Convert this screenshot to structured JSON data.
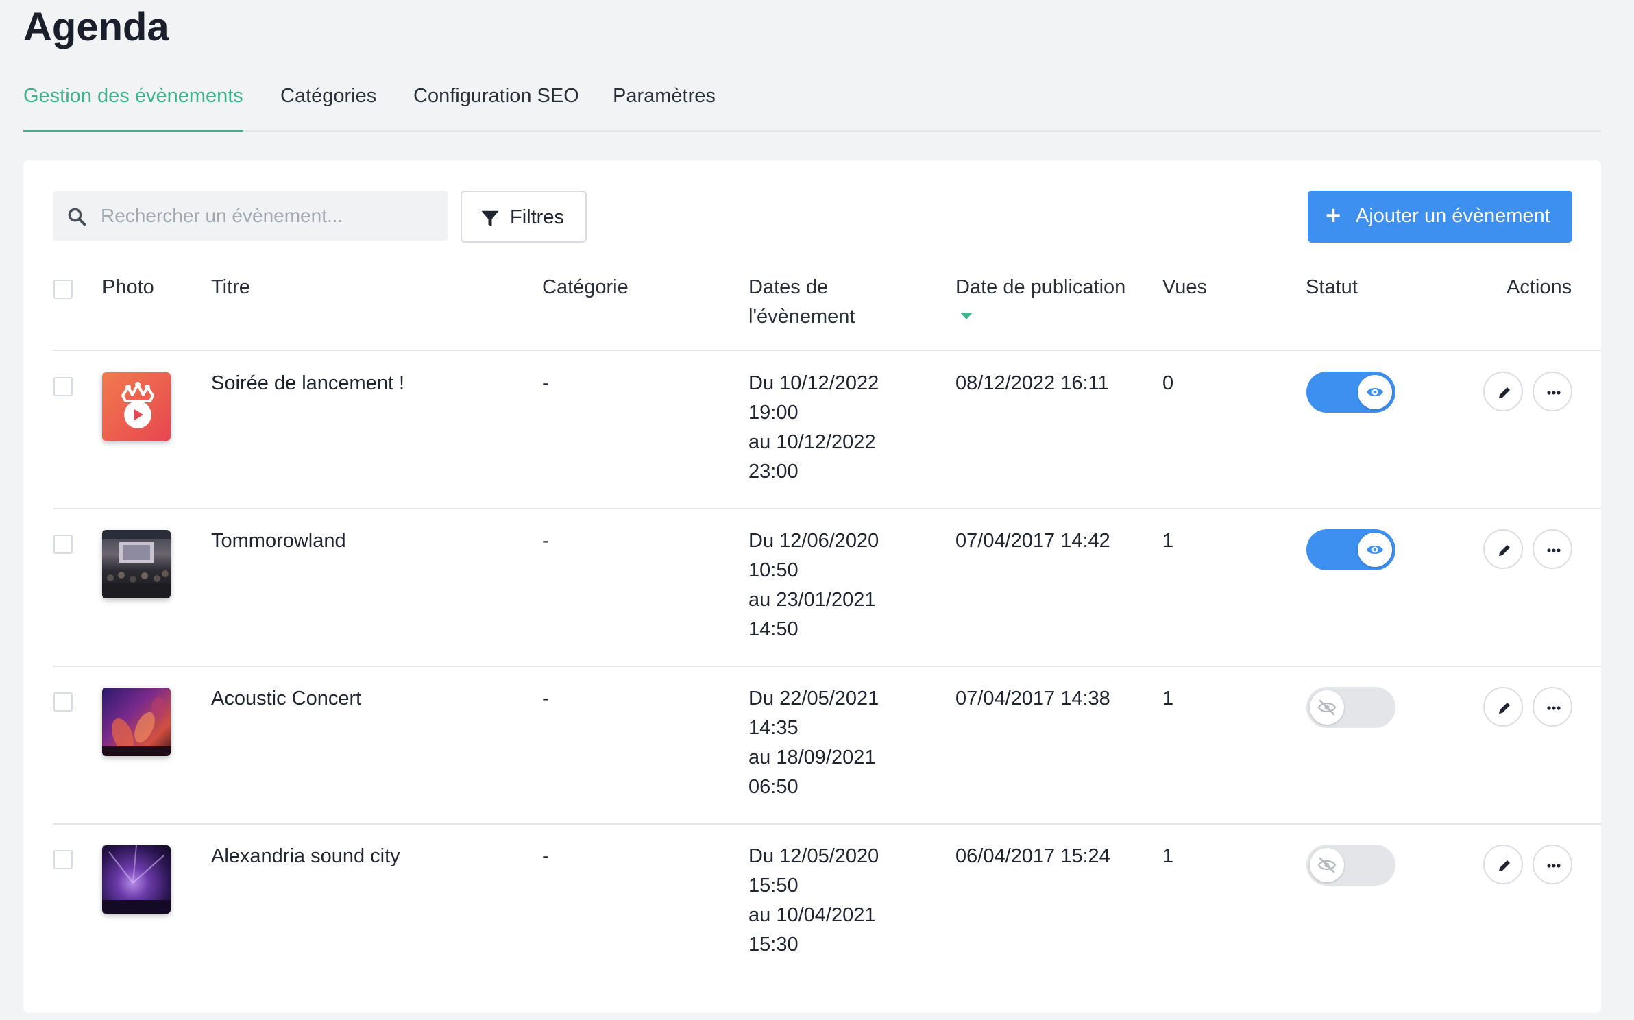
{
  "page": {
    "title": "Agenda"
  },
  "tabs": [
    {
      "label": "Gestion des évènements",
      "active": true
    },
    {
      "label": "Catégories",
      "active": false
    },
    {
      "label": "Configuration SEO",
      "active": false
    },
    {
      "label": "Paramètres",
      "active": false
    }
  ],
  "toolbar": {
    "search_placeholder": "Rechercher un évènement...",
    "filters_label": "Filtres",
    "add_label": "Ajouter un évènement"
  },
  "table": {
    "headers": {
      "photo": "Photo",
      "title": "Titre",
      "category": "Catégorie",
      "dates_line1": "Dates de",
      "dates_line2": "l'évènement",
      "publication": "Date de publication",
      "views": "Vues",
      "status": "Statut",
      "actions": "Actions"
    },
    "sort": {
      "column": "Date de publication",
      "direction": "desc"
    },
    "rows": [
      {
        "title": "Soirée de lancement !",
        "category": "-",
        "date_line1": "Du 10/12/2022",
        "date_line2": "19:00",
        "date_line3": "au 10/12/2022",
        "date_line4": "23:00",
        "published": "08/12/2022 16:11",
        "views": "0",
        "visible": true,
        "thumbnail": "logo-icon"
      },
      {
        "title": "Tommorowland",
        "category": "-",
        "date_line1": "Du 12/06/2020",
        "date_line2": "10:50",
        "date_line3": "au 23/01/2021",
        "date_line4": "14:50",
        "published": "07/04/2017 14:42",
        "views": "1",
        "visible": true,
        "thumbnail": "festival-stage-photo"
      },
      {
        "title": "Acoustic Concert",
        "category": "-",
        "date_line1": "Du 22/05/2021",
        "date_line2": "14:35",
        "date_line3": "au 18/09/2021",
        "date_line4": "06:50",
        "published": "07/04/2017 14:38",
        "views": "1",
        "visible": false,
        "thumbnail": "concert-hands-photo"
      },
      {
        "title": "Alexandria sound city",
        "category": "-",
        "date_line1": "Du 12/05/2020",
        "date_line2": "15:50",
        "date_line3": "au 10/04/2021",
        "date_line4": "15:30",
        "published": "06/04/2017 15:24",
        "views": "1",
        "visible": false,
        "thumbnail": "purple-concert-photo"
      }
    ]
  },
  "colors": {
    "accent_green": "#3db38b",
    "primary_blue": "#3d8ff0",
    "toggle_off": "#e4e5e8"
  }
}
